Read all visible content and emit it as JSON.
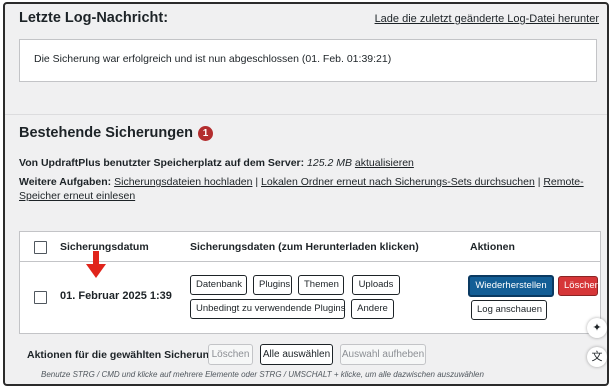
{
  "log": {
    "title": "Letzte Log-Nachricht:",
    "link": "Lade die zuletzt geänderte Log-Datei herunter",
    "message": "Die Sicherung war erfolgreich und ist nun abgeschlossen (01. Feb. 01:39:21)"
  },
  "backups": {
    "title": "Bestehende Sicherungen",
    "count": "1",
    "storage_label": "Von UpdraftPlus benutzter Speicherplatz auf dem Server:",
    "storage_value": "125.2 MB",
    "storage_refresh": "aktualisieren",
    "tasks_label": "Weitere Aufgaben:",
    "tasks": [
      "Sicherungsdateien hochladen",
      "Lokalen Ordner erneut nach Sicherungs-Sets durchsuchen",
      "Remote-Speicher erneut einlesen"
    ],
    "task_separator": " | "
  },
  "table": {
    "headers": {
      "date": "Sicherungsdatum",
      "data": "Sicherungsdaten (zum Herunterladen klicken)",
      "actions": "Aktionen"
    },
    "rows": [
      {
        "date": "01. Februar 2025 1:39",
        "data_buttons": [
          "Datenbank",
          "Plugins",
          "Themen",
          "Uploads",
          "Unbedingt zu verwendende Plugins",
          "Andere"
        ],
        "actions": {
          "restore": "Wiederherstellen",
          "delete": "Löschen",
          "view_log": "Log anschauen"
        }
      }
    ]
  },
  "bulk": {
    "label": "Aktionen für die gewählten Sicherungen",
    "delete": "Löschen",
    "select_all": "Alle auswählen",
    "deselect": "Auswahl aufheben",
    "hint": "Benutze STRG / CMD und klicke auf mehrere Elemente oder STRG / UMSCHALT + klicke, um alle dazwischen auszuwählen"
  },
  "colors": {
    "accent_blue": "#135e96",
    "danger_red": "#d63638",
    "badge_red": "#b32d2e",
    "arrow_red": "#e0241b"
  },
  "icons": [
    "sparkle-icon",
    "translate-icon",
    "arrow-down-icon"
  ]
}
